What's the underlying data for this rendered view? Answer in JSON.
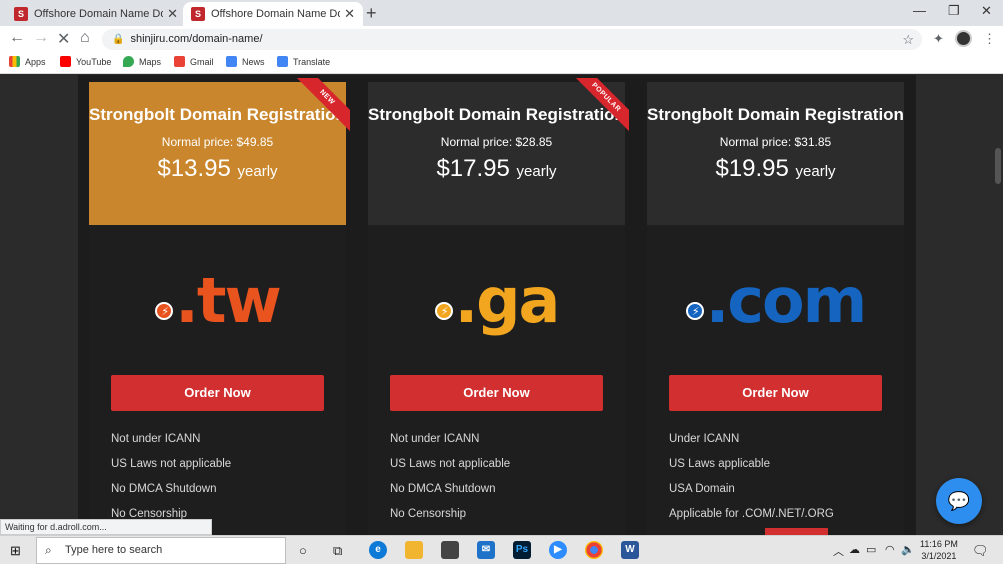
{
  "browser": {
    "tabs": [
      {
        "title": "Offshore Domain Name Domain",
        "active": false
      },
      {
        "title": "Offshore Domain Name Domain",
        "active": true
      }
    ],
    "url": "shinjiru.com/domain-name/",
    "bookmarks": [
      "Apps",
      "YouTube",
      "Maps",
      "Gmail",
      "News",
      "Translate"
    ],
    "status_text": "Waiting for d.adroll.com..."
  },
  "cards": [
    {
      "title": "Strongbolt Domain Registration",
      "normal_price": "Normal price: $49.85",
      "price": "$13.95",
      "period": "yearly",
      "ribbon": "NEW",
      "tld": ".tw",
      "tld_color": "#e9531e",
      "header_color": "#c9862c",
      "bolt_color": "#e9531e",
      "order_label": "Order Now",
      "features": [
        "Not under ICANN",
        "US Laws not applicable",
        "No DMCA Shutdown",
        "No Censorship"
      ]
    },
    {
      "title": "Strongbolt Domain Registration",
      "normal_price": "Normal price: $28.85",
      "price": "$17.95",
      "period": "yearly",
      "ribbon": "POPULAR",
      "tld": ".ga",
      "tld_color": "#f2a61f",
      "header_color": "#2c2c2c",
      "bolt_color": "#f2a61f",
      "order_label": "Order Now",
      "features": [
        "Not under ICANN",
        "US Laws not applicable",
        "No DMCA Shutdown",
        "No Censorship"
      ]
    },
    {
      "title": "Strongbolt Domain Registration",
      "normal_price": "Normal price: $31.85",
      "price": "$19.95",
      "period": "yearly",
      "ribbon": "",
      "tld": ".com",
      "tld_color": "#1565c0",
      "header_color": "#2c2c2c",
      "bolt_color": "#1565c0",
      "order_label": "Order Now",
      "features": [
        "Under ICANN",
        "US Laws applicable",
        "USA Domain",
        "Applicable for .COM/.NET/.ORG"
      ]
    }
  ],
  "taskbar": {
    "search_placeholder": "Type here to search",
    "time": "11:16 PM",
    "date": "3/1/2021"
  }
}
